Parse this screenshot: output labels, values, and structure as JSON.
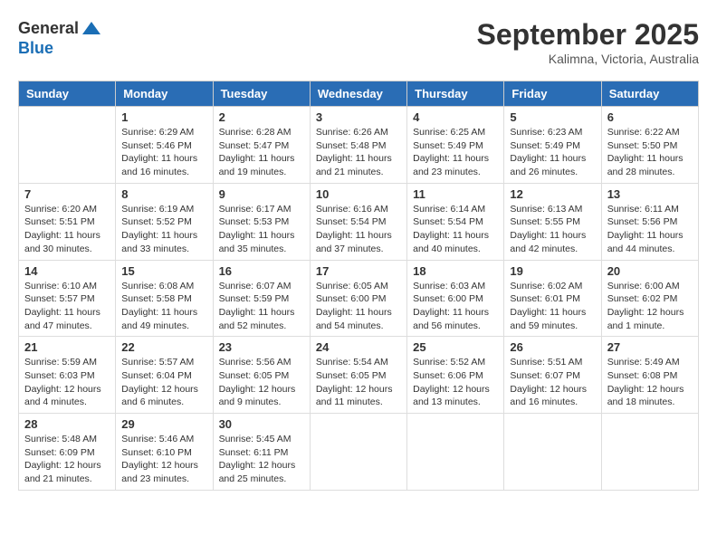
{
  "header": {
    "logo": {
      "general": "General",
      "blue": "Blue"
    },
    "title": "September 2025",
    "location": "Kalimna, Victoria, Australia"
  },
  "weekdays": [
    "Sunday",
    "Monday",
    "Tuesday",
    "Wednesday",
    "Thursday",
    "Friday",
    "Saturday"
  ],
  "weeks": [
    [
      {
        "day": "",
        "info": ""
      },
      {
        "day": "1",
        "info": "Sunrise: 6:29 AM\nSunset: 5:46 PM\nDaylight: 11 hours\nand 16 minutes."
      },
      {
        "day": "2",
        "info": "Sunrise: 6:28 AM\nSunset: 5:47 PM\nDaylight: 11 hours\nand 19 minutes."
      },
      {
        "day": "3",
        "info": "Sunrise: 6:26 AM\nSunset: 5:48 PM\nDaylight: 11 hours\nand 21 minutes."
      },
      {
        "day": "4",
        "info": "Sunrise: 6:25 AM\nSunset: 5:49 PM\nDaylight: 11 hours\nand 23 minutes."
      },
      {
        "day": "5",
        "info": "Sunrise: 6:23 AM\nSunset: 5:49 PM\nDaylight: 11 hours\nand 26 minutes."
      },
      {
        "day": "6",
        "info": "Sunrise: 6:22 AM\nSunset: 5:50 PM\nDaylight: 11 hours\nand 28 minutes."
      }
    ],
    [
      {
        "day": "7",
        "info": "Sunrise: 6:20 AM\nSunset: 5:51 PM\nDaylight: 11 hours\nand 30 minutes."
      },
      {
        "day": "8",
        "info": "Sunrise: 6:19 AM\nSunset: 5:52 PM\nDaylight: 11 hours\nand 33 minutes."
      },
      {
        "day": "9",
        "info": "Sunrise: 6:17 AM\nSunset: 5:53 PM\nDaylight: 11 hours\nand 35 minutes."
      },
      {
        "day": "10",
        "info": "Sunrise: 6:16 AM\nSunset: 5:54 PM\nDaylight: 11 hours\nand 37 minutes."
      },
      {
        "day": "11",
        "info": "Sunrise: 6:14 AM\nSunset: 5:54 PM\nDaylight: 11 hours\nand 40 minutes."
      },
      {
        "day": "12",
        "info": "Sunrise: 6:13 AM\nSunset: 5:55 PM\nDaylight: 11 hours\nand 42 minutes."
      },
      {
        "day": "13",
        "info": "Sunrise: 6:11 AM\nSunset: 5:56 PM\nDaylight: 11 hours\nand 44 minutes."
      }
    ],
    [
      {
        "day": "14",
        "info": "Sunrise: 6:10 AM\nSunset: 5:57 PM\nDaylight: 11 hours\nand 47 minutes."
      },
      {
        "day": "15",
        "info": "Sunrise: 6:08 AM\nSunset: 5:58 PM\nDaylight: 11 hours\nand 49 minutes."
      },
      {
        "day": "16",
        "info": "Sunrise: 6:07 AM\nSunset: 5:59 PM\nDaylight: 11 hours\nand 52 minutes."
      },
      {
        "day": "17",
        "info": "Sunrise: 6:05 AM\nSunset: 6:00 PM\nDaylight: 11 hours\nand 54 minutes."
      },
      {
        "day": "18",
        "info": "Sunrise: 6:03 AM\nSunset: 6:00 PM\nDaylight: 11 hours\nand 56 minutes."
      },
      {
        "day": "19",
        "info": "Sunrise: 6:02 AM\nSunset: 6:01 PM\nDaylight: 11 hours\nand 59 minutes."
      },
      {
        "day": "20",
        "info": "Sunrise: 6:00 AM\nSunset: 6:02 PM\nDaylight: 12 hours\nand 1 minute."
      }
    ],
    [
      {
        "day": "21",
        "info": "Sunrise: 5:59 AM\nSunset: 6:03 PM\nDaylight: 12 hours\nand 4 minutes."
      },
      {
        "day": "22",
        "info": "Sunrise: 5:57 AM\nSunset: 6:04 PM\nDaylight: 12 hours\nand 6 minutes."
      },
      {
        "day": "23",
        "info": "Sunrise: 5:56 AM\nSunset: 6:05 PM\nDaylight: 12 hours\nand 9 minutes."
      },
      {
        "day": "24",
        "info": "Sunrise: 5:54 AM\nSunset: 6:05 PM\nDaylight: 12 hours\nand 11 minutes."
      },
      {
        "day": "25",
        "info": "Sunrise: 5:52 AM\nSunset: 6:06 PM\nDaylight: 12 hours\nand 13 minutes."
      },
      {
        "day": "26",
        "info": "Sunrise: 5:51 AM\nSunset: 6:07 PM\nDaylight: 12 hours\nand 16 minutes."
      },
      {
        "day": "27",
        "info": "Sunrise: 5:49 AM\nSunset: 6:08 PM\nDaylight: 12 hours\nand 18 minutes."
      }
    ],
    [
      {
        "day": "28",
        "info": "Sunrise: 5:48 AM\nSunset: 6:09 PM\nDaylight: 12 hours\nand 21 minutes."
      },
      {
        "day": "29",
        "info": "Sunrise: 5:46 AM\nSunset: 6:10 PM\nDaylight: 12 hours\nand 23 minutes."
      },
      {
        "day": "30",
        "info": "Sunrise: 5:45 AM\nSunset: 6:11 PM\nDaylight: 12 hours\nand 25 minutes."
      },
      {
        "day": "",
        "info": ""
      },
      {
        "day": "",
        "info": ""
      },
      {
        "day": "",
        "info": ""
      },
      {
        "day": "",
        "info": ""
      }
    ]
  ]
}
